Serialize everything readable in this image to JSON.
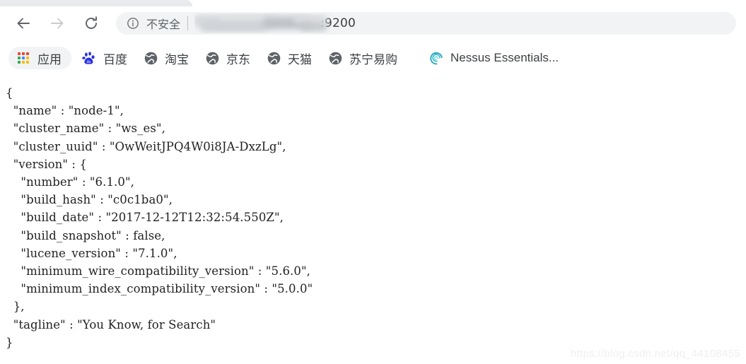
{
  "browser": {
    "nav": {
      "back_icon": "arrow-left-icon",
      "forward_icon": "arrow-right-icon",
      "reload_icon": "reload-icon",
      "forward_disabled": true
    },
    "omnibox": {
      "info_icon": "info-circle-icon",
      "security_label": "不安全",
      "url_visible_text": ":9200",
      "url_redacted": true
    },
    "bookmarks": [
      {
        "label": "应用",
        "icon": "apps-grid-icon",
        "pill": true
      },
      {
        "label": "百度",
        "icon": "baidu-paw-icon",
        "pill": false
      },
      {
        "label": "淘宝",
        "icon": "globe-icon",
        "pill": false
      },
      {
        "label": "京东",
        "icon": "globe-icon",
        "pill": false
      },
      {
        "label": "天猫",
        "icon": "globe-icon",
        "pill": false
      },
      {
        "label": "苏宁易购",
        "icon": "globe-icon",
        "pill": false
      },
      {
        "label": "Nessus Essentials...",
        "icon": "nessus-spiral-icon",
        "pill": false
      }
    ]
  },
  "page": {
    "body_text": "{\n  \"name\" : \"node-1\",\n  \"cluster_name\" : \"ws_es\",\n  \"cluster_uuid\" : \"OwWeitJPQ4W0i8JA-DxzLg\",\n  \"version\" : {\n    \"number\" : \"6.1.0\",\n    \"build_hash\" : \"c0c1ba0\",\n    \"build_date\" : \"2017-12-12T12:32:54.550Z\",\n    \"build_snapshot\" : false,\n    \"lucene_version\" : \"7.1.0\",\n    \"minimum_wire_compatibility_version\" : \"5.6.0\",\n    \"minimum_index_compatibility_version\" : \"5.0.0\"\n  },\n  \"tagline\" : \"You Know, for Search\"\n}",
    "json_values": {
      "name": "node-1",
      "cluster_name": "ws_es",
      "cluster_uuid": "OwWeitJPQ4W0i8JA-DxzLg",
      "version": {
        "number": "6.1.0",
        "build_hash": "c0c1ba0",
        "build_date": "2017-12-12T12:32:54.550Z",
        "build_snapshot": "false",
        "lucene_version": "7.1.0",
        "minimum_wire_compatibility_version": "5.6.0",
        "minimum_index_compatibility_version": "5.0.0"
      },
      "tagline": "You Know, for Search"
    }
  },
  "watermark": {
    "text": "https://blog.csdn.net/qq_44108455"
  },
  "colors": {
    "chrome_toolbar": "#ffffff",
    "omnibox_bg": "#f1f3f4",
    "tab_gray": "#e8eaed",
    "text_dark": "#3c4043",
    "text_muted": "#5f6368",
    "json_text": "#222222",
    "baidu_blue": "#2932e1",
    "nessus_teal": "#2aa8b8",
    "watermark_gray": "#efefef"
  }
}
